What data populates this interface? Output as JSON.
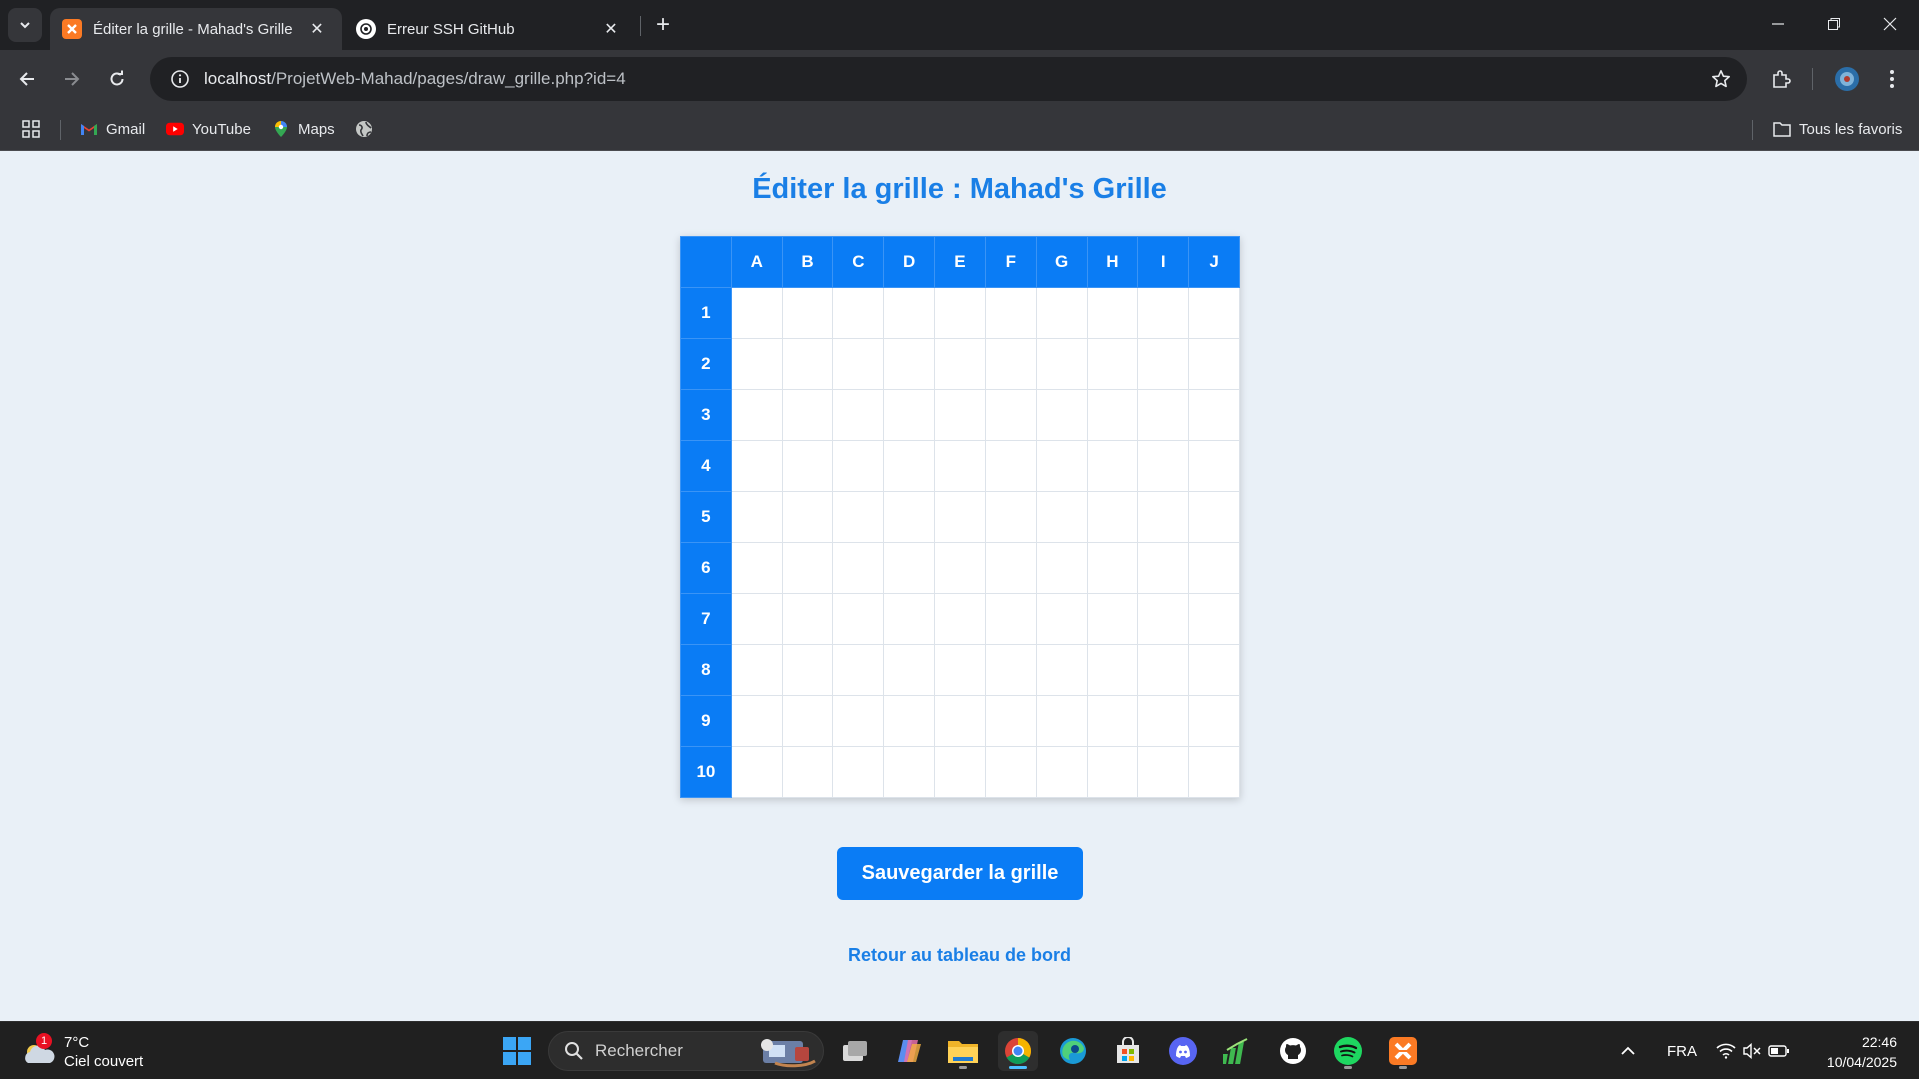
{
  "browser": {
    "tabs": [
      {
        "title": "Éditer la grille - Mahad's Grille",
        "active": true,
        "favicon": "xampp-icon"
      },
      {
        "title": "Erreur SSH GitHub",
        "active": false,
        "favicon": "openai-icon"
      }
    ],
    "url": {
      "host": "localhost",
      "path": "/ProjetWeb-Mahad/pages/draw_grille.php?id=4"
    },
    "bookmarks": [
      {
        "label": "Gmail",
        "icon": "gmail-icon"
      },
      {
        "label": "YouTube",
        "icon": "youtube-icon"
      },
      {
        "label": "Maps",
        "icon": "maps-icon"
      }
    ],
    "all_bookmarks_label": "Tous les favoris"
  },
  "page": {
    "title": "Éditer la grille : Mahad's Grille",
    "columns": [
      "A",
      "B",
      "C",
      "D",
      "E",
      "F",
      "G",
      "H",
      "I",
      "J"
    ],
    "rows": [
      "1",
      "2",
      "3",
      "4",
      "5",
      "6",
      "7",
      "8",
      "9",
      "10"
    ],
    "save_label": "Sauvegarder la grille",
    "back_label": "Retour au tableau de bord",
    "colors": {
      "accent": "#0a7cf5",
      "title": "#1a7fe6",
      "background": "#e9f0f7"
    }
  },
  "taskbar": {
    "weather": {
      "temp": "7°C",
      "condition": "Ciel couvert",
      "badge": "1"
    },
    "search_placeholder": "Rechercher",
    "language": "FRA",
    "time": "22:46",
    "date": "10/04/2025"
  }
}
